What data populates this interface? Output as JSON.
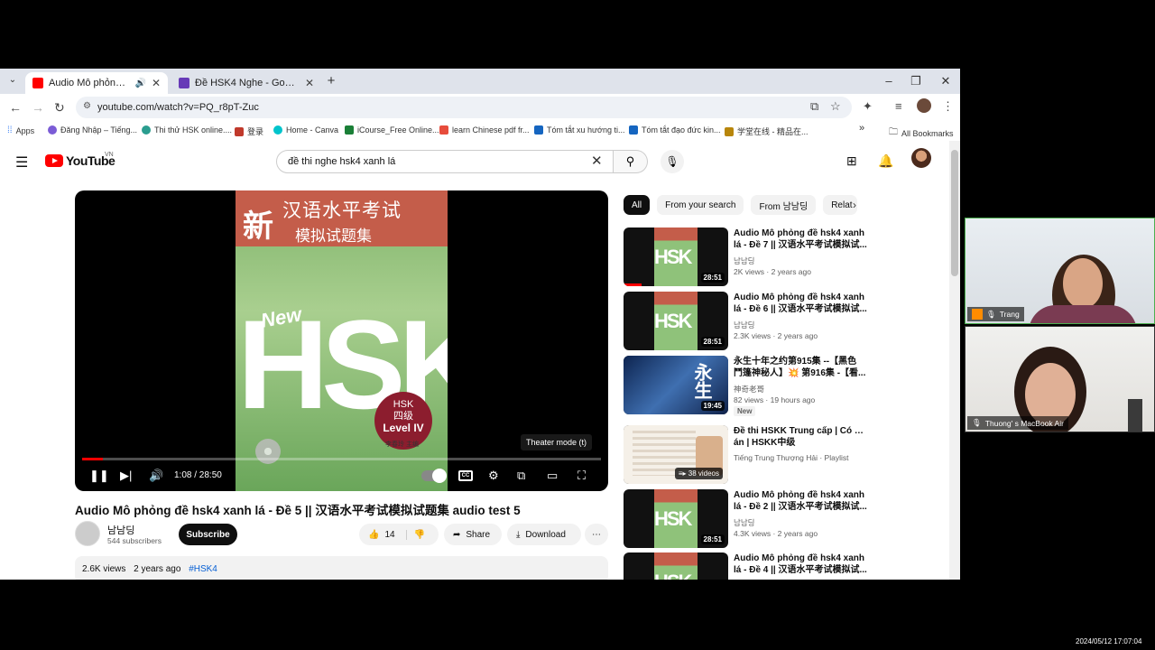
{
  "browser": {
    "tabs": [
      {
        "label": "Audio Mô phỏng đề hsk4 x",
        "active": true
      },
      {
        "label": "Đề HSK4 Nghe - Google Forms",
        "active": false
      }
    ],
    "url": "youtube.com/watch?v=PQ_r8pT-Zuc",
    "bookmarks": [
      "Apps",
      "Đăng Nhập – Tiếng...",
      "Thi thử HSK online....",
      "登录",
      "Home - Canva",
      "iCourse_Free Online...",
      "learn Chinese pdf fr...",
      "Tóm tắt xu hướng ti...",
      "Tóm tắt đạo đức kin...",
      "学堂在线 - 精品在..."
    ],
    "all_bookmarks": "All Bookmarks"
  },
  "youtube": {
    "logo_text": "YouTube",
    "region": "VN",
    "search_query": "đề thi nghe hsk4 xanh lá",
    "player": {
      "cover_xin": "新",
      "cover_title_1": "汉语水平考试",
      "cover_title_2": "模拟试题集",
      "cover_new": "New",
      "cover_hsk": "HSK",
      "cover_level_1": "HSK",
      "cover_level_2": "四级",
      "cover_level_3": "Level IV",
      "cover_author": "李春玲 主编",
      "tooltip": "Theater mode (t)",
      "time": "1:08 / 28:50",
      "progress_fraction": 0.04
    },
    "video": {
      "title": "Audio Mô phỏng đề hsk4 xanh lá - Đề 5 || 汉语水平考试模拟试题集 audio test 5",
      "channel": "남남딩",
      "subscribers": "544 subscribers",
      "subscribe_label": "Subscribe",
      "likes": "14",
      "share_label": "Share",
      "download_label": "Download",
      "views": "2.6K views",
      "age": "2 years ago",
      "hashtag": "#HSK4"
    },
    "chips": [
      "All",
      "From your search",
      "From 남남딩",
      "Relat"
    ],
    "recommendations": [
      {
        "line1": "Audio Mô phỏng đề hsk4 xanh",
        "line2": "lá - Đề 7 || 汉语水平考试模拟试...",
        "channel": "남남딩",
        "meta": "2K views · 2 years ago",
        "duration": "28:51"
      },
      {
        "line1": "Audio Mô phỏng đề hsk4 xanh",
        "line2": "lá - Đề 6 || 汉语水平考试模拟试...",
        "channel": "남남딩",
        "meta": "2.3K views · 2 years ago",
        "duration": "28:51"
      },
      {
        "line1": "永生十年之约第915集 --【黑色",
        "line2": "鬥篷神秘人】💥 第916集 -【看...",
        "channel": "神奇老哥",
        "meta": "82 views · 19 hours ago",
        "duration": "19:45",
        "badge": "New"
      },
      {
        "line1": "Đề thi HSKK Trung cấp | Có đáp",
        "line2": "án | HSKK中级",
        "channel": "Tiếng Trung Thượng Hải · Playlist",
        "meta": "",
        "duration": "38 videos"
      },
      {
        "line1": "Audio Mô phỏng đề hsk4 xanh",
        "line2": "lá - Đề 2 || 汉语水平考试模拟试...",
        "channel": "남남딩",
        "meta": "4.3K views · 2 years ago",
        "duration": "28:51"
      },
      {
        "line1": "Audio Mô phỏng đề hsk4 xanh",
        "line2": "lá - Đề 4 || 汉语水平考试模拟试...",
        "channel": "",
        "meta": "",
        "duration": ""
      }
    ]
  },
  "call": {
    "participant_1": "Trang",
    "participant_2": "Thuong'  s MacBook Air"
  },
  "timestamp": "2024/05/12 17:07:04"
}
